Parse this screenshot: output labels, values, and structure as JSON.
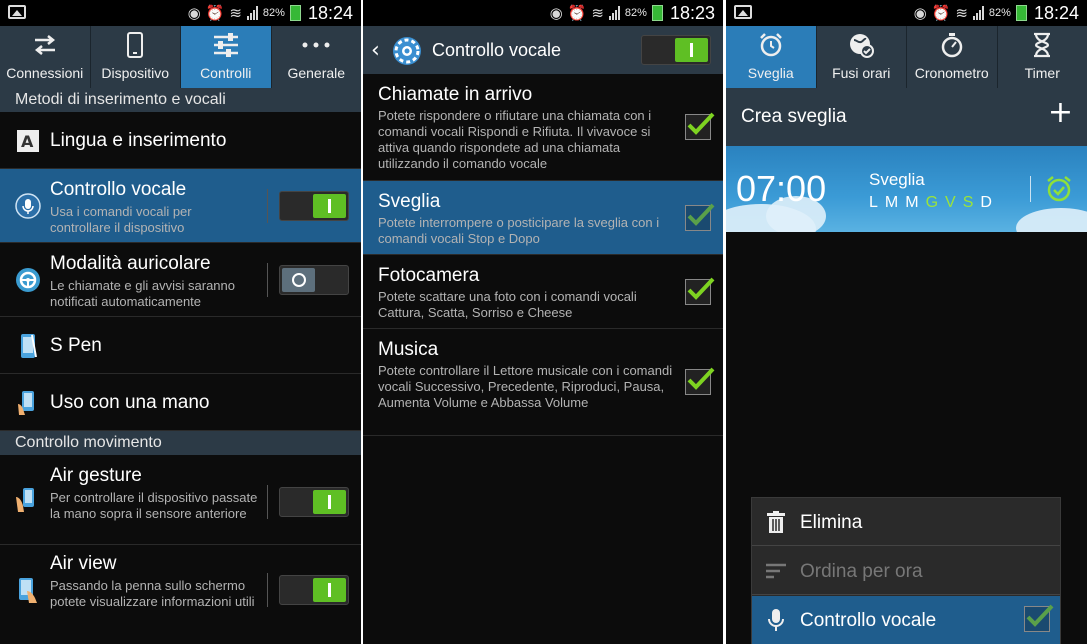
{
  "status_left": {
    "battery": "82%",
    "time": "18:24"
  },
  "status_mid": {
    "battery": "82%",
    "time": "18:23"
  },
  "status_right": {
    "battery": "82%",
    "time": "18:24"
  },
  "settings": {
    "tabs": [
      {
        "label": "Connessioni",
        "icon": "arrows-icon"
      },
      {
        "label": "Dispositivo",
        "icon": "phone-icon"
      },
      {
        "label": "Controlli",
        "icon": "sliders-icon"
      },
      {
        "label": "Generale",
        "icon": "more-icon"
      }
    ],
    "section1": "Metodi di inserimento e vocali",
    "items1": [
      {
        "title": "Lingua e inserimento"
      },
      {
        "title": "Controllo vocale",
        "sub": "Usa i comandi vocali per controllare il dispositivo",
        "switch": "on"
      },
      {
        "title": "Modalità auricolare",
        "sub": "Le chiamate e gli avvisi saranno notificati automaticamente",
        "switch": "off"
      },
      {
        "title": "S Pen"
      },
      {
        "title": "Uso con una mano"
      }
    ],
    "section2": "Controllo movimento",
    "items2": [
      {
        "title": "Air gesture",
        "sub": "Per controllare il dispositivo passate la mano sopra il sensore anteriore",
        "switch": "on"
      },
      {
        "title": "Air view",
        "sub": "Passando la penna sullo schermo potete visualizzare informazioni utili",
        "switch": "on"
      }
    ]
  },
  "voice": {
    "title": "Controllo vocale",
    "switch": "on",
    "items": [
      {
        "title": "Chiamate in arrivo",
        "sub": "Potete rispondere o rifiutare una chiamata con i comandi vocali Rispondi e Rifiuta. Il vivavoce si attiva quando rispondete ad una chiamata utilizzando il comando vocale",
        "checked": true
      },
      {
        "title": "Sveglia",
        "sub": "Potete interrompere o posticipare la sveglia con i comandi vocali Stop e Dopo",
        "checked": true
      },
      {
        "title": "Fotocamera",
        "sub": "Potete scattare una foto con i comandi vocali Cattura, Scatta, Sorriso e Cheese",
        "checked": true
      },
      {
        "title": "Musica",
        "sub": "Potete controllare il Lettore musicale con i comandi vocali Successivo, Precedente, Riproduci, Pausa, Aumenta Volume e Abbassa Volume",
        "checked": true
      }
    ]
  },
  "clock": {
    "tabs": [
      {
        "label": "Sveglia",
        "icon": "alarm-clock-icon"
      },
      {
        "label": "Fusi orari",
        "icon": "globe-icon"
      },
      {
        "label": "Cronometro",
        "icon": "stopwatch-icon"
      },
      {
        "label": "Timer",
        "icon": "hourglass-icon"
      }
    ],
    "create_label": "Crea sveglia",
    "alarm": {
      "time": "07:00",
      "name": "Sveglia",
      "days": [
        "L",
        "M",
        "M",
        "G",
        "V",
        "S",
        "D"
      ],
      "active_days": [
        false,
        false,
        false,
        true,
        true,
        true,
        false
      ]
    },
    "menu": [
      {
        "label": "Elimina",
        "icon": "trash-icon",
        "enabled": true
      },
      {
        "label": "Ordina per ora",
        "icon": "sort-icon",
        "enabled": false
      },
      {
        "label": "Controllo vocale",
        "icon": "mic-icon",
        "enabled": true,
        "checked": true
      }
    ]
  },
  "colors": {
    "accent": "#2b7db8",
    "selected": "#1f5d8d",
    "header": "#2c3a46",
    "switch_on": "#5fbf24",
    "check": "#7ed321"
  }
}
